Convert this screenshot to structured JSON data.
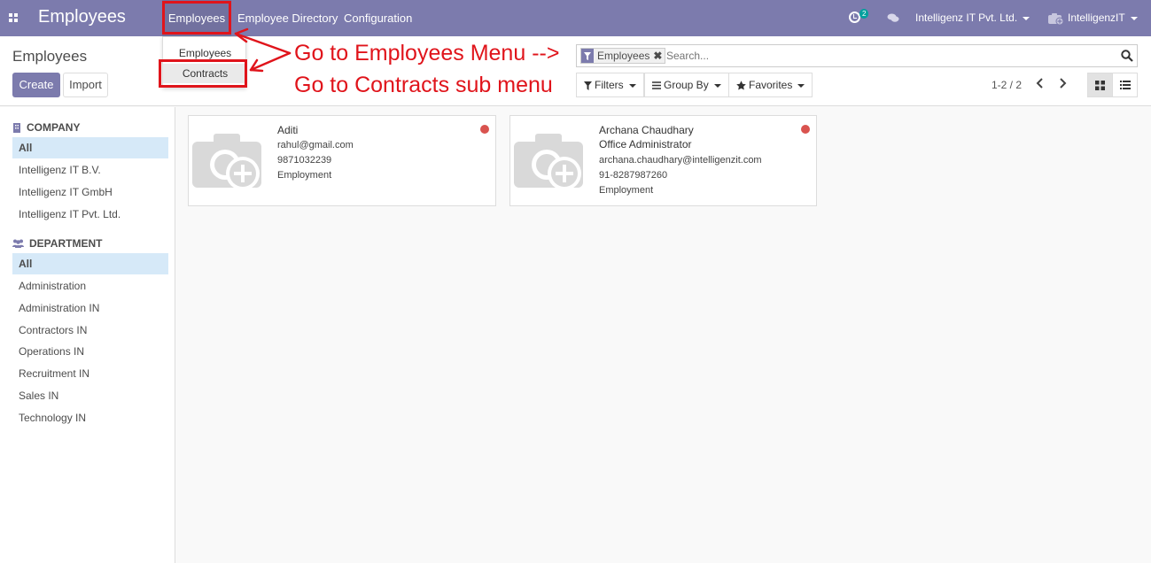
{
  "navbar": {
    "app_title": "Employees",
    "menus": [
      "Employees",
      "Employee Directory",
      "Configuration"
    ],
    "activity_count": "2",
    "company": "Intelligenz IT Pvt. Ltd.",
    "user": "IntelligenzIT",
    "color": "#7c7bad"
  },
  "dropdown": {
    "items": [
      "Employees",
      "Contracts"
    ]
  },
  "annotations": {
    "line1": "Go to Employees Menu -->",
    "line2": "Go to Contracts sub menu",
    "color": "#e0141b"
  },
  "control": {
    "breadcrumb": "Employees",
    "create_label": "Create",
    "import_label": "Import",
    "facet_label": "Employees",
    "facet_remove": "✖",
    "search_placeholder": "Search...",
    "filters_label": "Filters",
    "groupby_label": "Group By",
    "favorites_label": "Favorites",
    "pager": "1-2 / 2"
  },
  "sidebar": {
    "company_title": "COMPANY",
    "companies": [
      "All",
      "Intelligenz IT B.V.",
      "Intelligenz IT GmbH",
      "Intelligenz IT Pvt. Ltd."
    ],
    "department_title": "DEPARTMENT",
    "departments": [
      "All",
      "Administration",
      "Administration IN",
      "Contractors IN",
      "Operations IN",
      "Recruitment IN",
      "Sales IN",
      "Technology IN"
    ]
  },
  "employees": [
    {
      "name": "Aditi",
      "job": "",
      "email": "rahul@gmail.com",
      "phone": "9871032239",
      "type": "Employment"
    },
    {
      "name": "Archana Chaudhary",
      "job": "Office Administrator",
      "email": "archana.chaudhary@intelligenzit.com",
      "phone": "91-8287987260",
      "type": "Employment"
    }
  ]
}
